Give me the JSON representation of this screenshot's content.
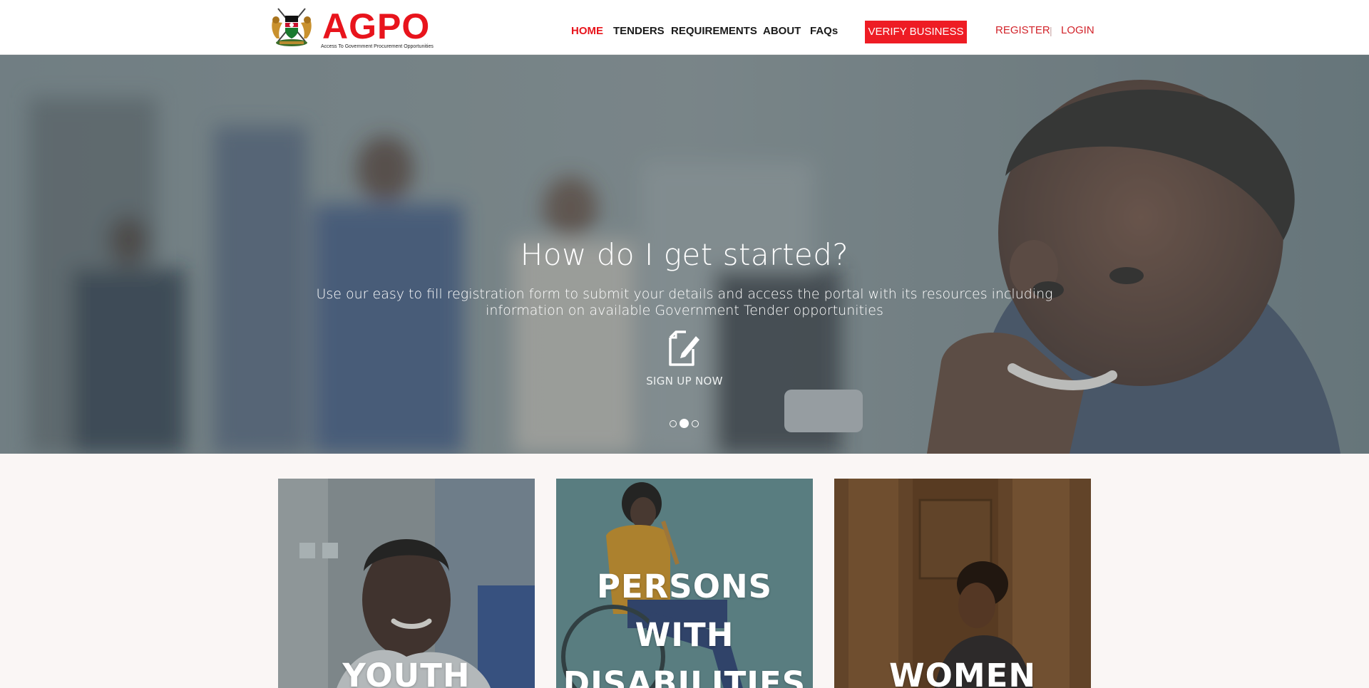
{
  "header": {
    "logo": {
      "wordmark": "AGPO",
      "tagline": "Access To Government Procurement Opportunities"
    },
    "nav": [
      {
        "label": "HOME",
        "active": true
      },
      {
        "label": "TENDERS",
        "active": false
      },
      {
        "label": "REQUIREMENTS",
        "active": false
      },
      {
        "label": "ABOUT",
        "active": false
      },
      {
        "label": "FAQs",
        "active": false
      }
    ],
    "verify_button": "VERIFY BUSINESS",
    "register": "REGISTER",
    "separator": "|",
    "login": "LOGIN"
  },
  "hero": {
    "title": "How do I get started?",
    "text": "Use our easy to fill registration form to submit your details and access the portal with its resources including information on available Government Tender opportunities",
    "icon": "document-edit-icon",
    "cta": "SIGN UP NOW",
    "slides": 3,
    "active_slide": 2
  },
  "cards": [
    {
      "title": "YOUTH"
    },
    {
      "title": "PERSONS WITH DISABILITIES"
    },
    {
      "title": "WOMEN"
    }
  ],
  "colors": {
    "brand_red": "#e8141c",
    "button_red": "#ee1c24",
    "link_red": "#d2232a",
    "page_bg": "#faf6f5"
  }
}
